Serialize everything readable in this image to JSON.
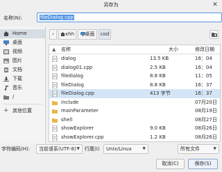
{
  "window": {
    "title": "另存为"
  },
  "name_row": {
    "label": "名称(N):",
    "value": "fileDialog.cpp"
  },
  "sidebar": {
    "items": [
      {
        "label": "Home",
        "icon": "home-icon"
      },
      {
        "label": "桌面",
        "icon": "desktop-icon"
      },
      {
        "label": "视频",
        "icon": "video-icon"
      },
      {
        "label": "图片",
        "icon": "picture-icon"
      },
      {
        "label": "文档",
        "icon": "document-icon"
      },
      {
        "label": "下载",
        "icon": "download-icon"
      },
      {
        "label": "音乐",
        "icon": "music-icon"
      },
      {
        "label": "/",
        "icon": "folder-icon"
      }
    ],
    "other_locations": "其他位置"
  },
  "pathbar": {
    "items": [
      "xhh",
      "桌面",
      "cod"
    ]
  },
  "filelist": {
    "headers": {
      "name": "名称",
      "size": "大小",
      "modified": "修改日期"
    },
    "rows": [
      {
        "name": "dialog",
        "size": "13.5 KB",
        "modified": "16：04",
        "type": "file"
      },
      {
        "name": "dialog01.cpp",
        "size": "2.5 KB",
        "modified": "16：04",
        "type": "file"
      },
      {
        "name": "filedialog",
        "size": "8.8 KB",
        "modified": "11：05",
        "type": "file"
      },
      {
        "name": "fileDialog",
        "size": "8.8 KB",
        "modified": "16：37",
        "type": "file"
      },
      {
        "name": "fileDialog.cpp",
        "size": "413 字节",
        "modified": "16：37",
        "type": "file",
        "selected": true
      },
      {
        "name": "include",
        "size": "",
        "modified": "07月20日",
        "type": "folder"
      },
      {
        "name": "mainParameter",
        "size": "",
        "modified": "08月19日",
        "type": "folder"
      },
      {
        "name": "shell",
        "size": "",
        "modified": "08月27日",
        "type": "folder"
      },
      {
        "name": "showExplorer",
        "size": "9.0 KB",
        "modified": "08月26日",
        "type": "file"
      },
      {
        "name": "showExplorer.cpp",
        "size": "1.2 KB",
        "modified": "08月26日",
        "type": "file"
      }
    ]
  },
  "bottom": {
    "encoding_label": "字符编码(H):",
    "encoding_value": "当前语系(UTF-8)",
    "lineend_label": "行尾(I)",
    "lineend_value": "Unix/Linux",
    "filter_value": "所有文件",
    "cancel_label": "取消(C)",
    "save_label": "保存(S)"
  },
  "colors": {
    "accent": "#5294e2",
    "selected_row": "#d4e5f7",
    "folder": "#e8b64a"
  }
}
